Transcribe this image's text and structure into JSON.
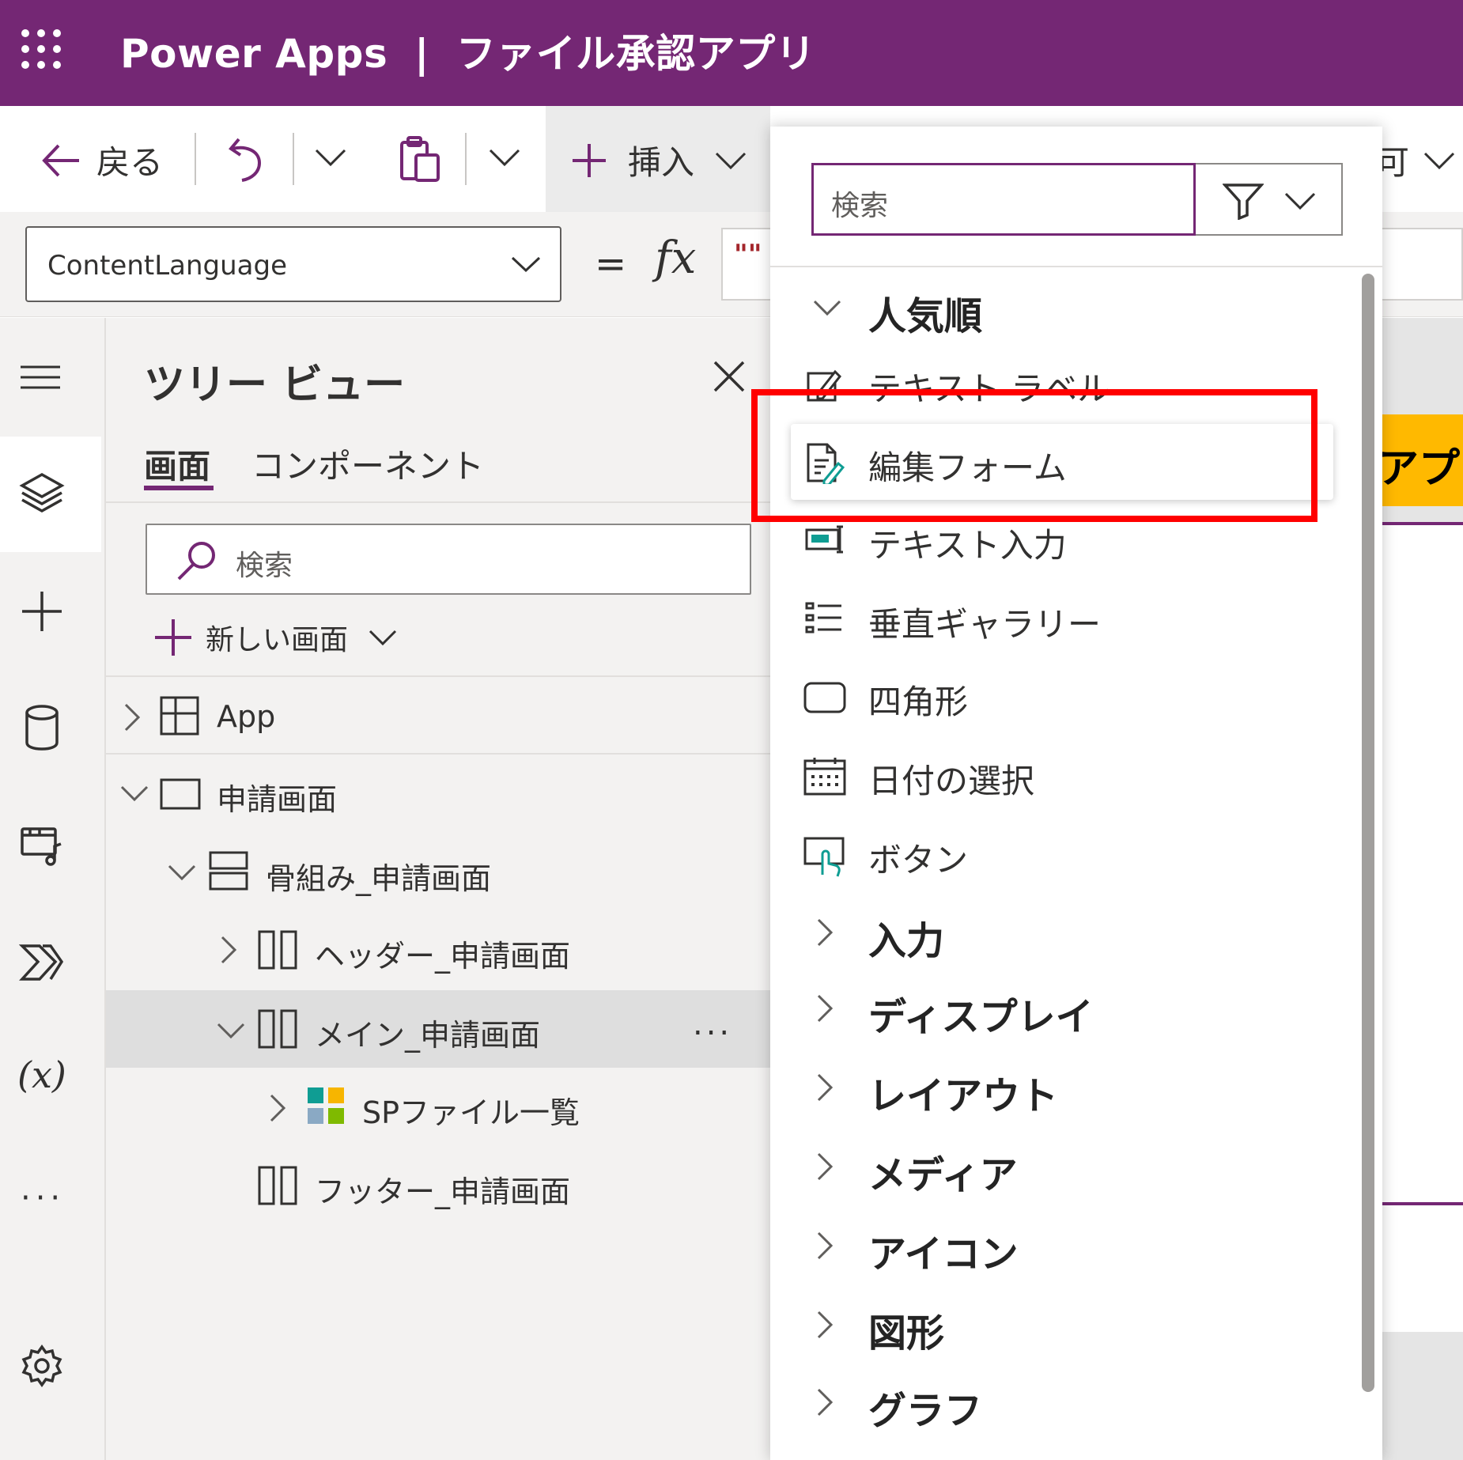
{
  "header": {
    "product": "Power Apps",
    "separator": "|",
    "app_name": "ファイル承認アプリ"
  },
  "command_bar": {
    "back_label": "戻る",
    "insert_label": "挿入",
    "partial_right_label": "可"
  },
  "formula_bar": {
    "property": "ContentLanguage",
    "equals": "=",
    "fx": "fx",
    "formula": "\"\""
  },
  "tree_view": {
    "title": "ツリー ビュー",
    "tabs": [
      "画面",
      "コンポーネント"
    ],
    "search_placeholder": "検索",
    "new_screen_label": "新しい画面",
    "nodes": {
      "app": "App",
      "screen": "申請画面",
      "skeleton": "骨組み_申請画面",
      "header_container": "ヘッダー_申請画面",
      "main_container": "メイン_申請画面",
      "gallery": "SPファイル一覧",
      "footer_container": "フッター_申請画面"
    },
    "more_label": "..."
  },
  "insert_panel": {
    "search_placeholder": "検索",
    "popular_header": "人気順",
    "popular_items": [
      {
        "label": "テキスト ラベル",
        "icon": "text-label-icon"
      },
      {
        "label": "編集フォーム",
        "icon": "edit-form-icon"
      },
      {
        "label": "テキスト入力",
        "icon": "text-input-icon"
      },
      {
        "label": "垂直ギャラリー",
        "icon": "vertical-gallery-icon"
      },
      {
        "label": "四角形",
        "icon": "rectangle-icon"
      },
      {
        "label": "日付の選択",
        "icon": "date-picker-icon"
      },
      {
        "label": "ボタン",
        "icon": "button-icon"
      }
    ],
    "categories": [
      "入力",
      "ディスプレイ",
      "レイアウト",
      "メディア",
      "アイコン",
      "図形",
      "グラフ"
    ]
  },
  "canvas": {
    "partial_title": "アプリ"
  },
  "colors": {
    "brand": "#742774",
    "highlight_box": "#ff0000",
    "canvas_banner": "#ffb900"
  }
}
